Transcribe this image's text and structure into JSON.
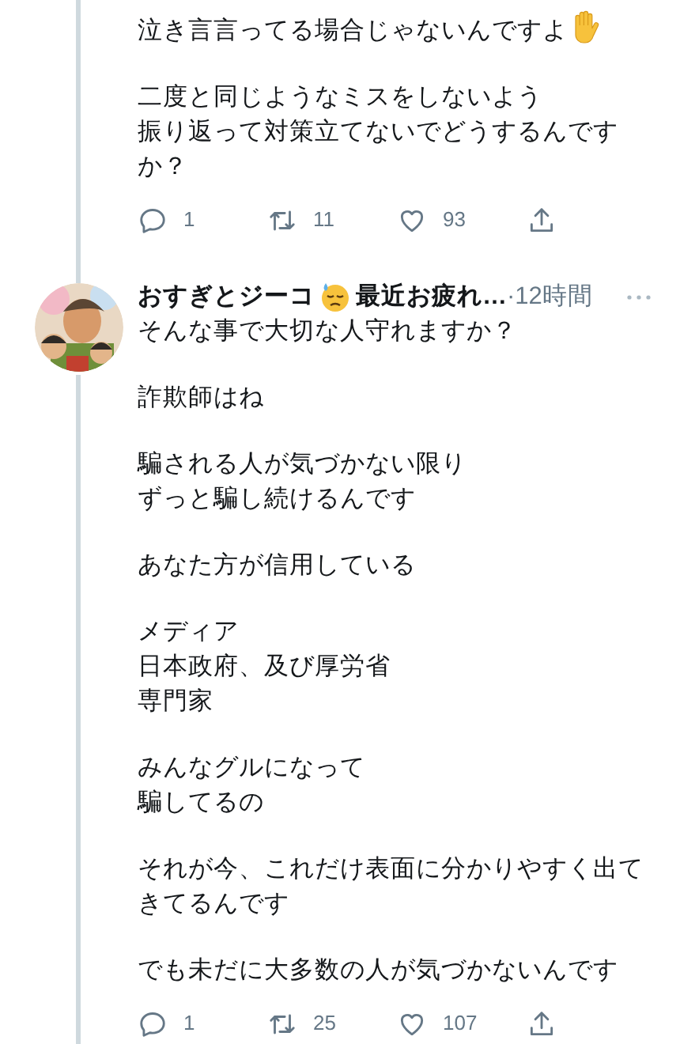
{
  "tweets": [
    {
      "paragraphs": [
        {
          "kind": "with_emoji",
          "lines": [
            "泣き言言ってる場合じゃないんですよ"
          ]
        },
        {
          "kind": "plain",
          "lines": [
            "二度と同じようなミスをしないよう",
            "振り返って対策立てないでどうするんです",
            "か？"
          ]
        }
      ],
      "actions": [
        {
          "kind": "reply",
          "count": "1"
        },
        {
          "kind": "retweet",
          "count": "11"
        },
        {
          "kind": "like",
          "count": "93"
        },
        {
          "kind": "share"
        }
      ]
    },
    {
      "author": {
        "name": "おすぎとジーコ",
        "status": "最近お疲れ…",
        "time": "·12時間"
      },
      "paragraphs": [
        {
          "kind": "plain",
          "lines": [
            "そんな事で大切な人守れますか？"
          ]
        },
        {
          "kind": "plain",
          "lines": [
            "詐欺師はね"
          ]
        },
        {
          "kind": "plain",
          "lines": [
            "騙される人が気づかない限り",
            "ずっと騙し続けるんです"
          ]
        },
        {
          "kind": "plain",
          "lines": [
            "あなた方が信用している"
          ]
        },
        {
          "kind": "plain",
          "lines": [
            "メディア",
            "日本政府、及び厚労省",
            "専門家"
          ]
        },
        {
          "kind": "plain",
          "lines": [
            "みんなグルになって",
            "騙してるの"
          ]
        },
        {
          "kind": "plain",
          "lines": [
            "それが今、これだけ表面に分かりやすく出て",
            "きてるんです"
          ]
        },
        {
          "kind": "plain",
          "lines": [
            "でも未だに大多数の人が気づかないんです"
          ]
        }
      ],
      "actions": [
        {
          "kind": "reply",
          "count": "1"
        },
        {
          "kind": "retweet",
          "count": "25"
        },
        {
          "kind": "like",
          "count": "107"
        },
        {
          "kind": "share"
        }
      ]
    }
  ]
}
